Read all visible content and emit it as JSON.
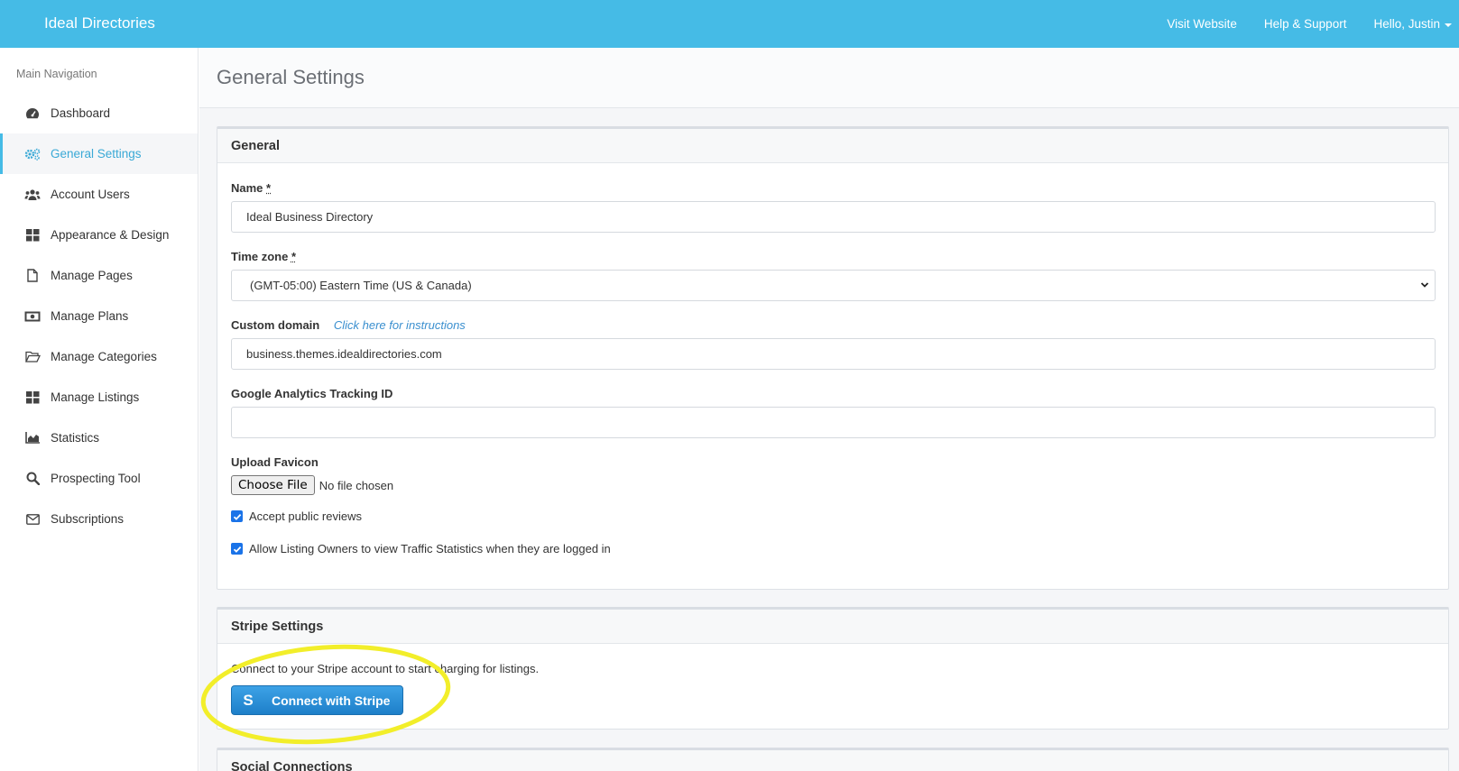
{
  "app": {
    "brand": "Ideal Directories",
    "nav": {
      "visit_website": "Visit Website",
      "help_support": "Help & Support",
      "user_greeting": "Hello, Justin"
    }
  },
  "sidebar": {
    "heading": "Main Navigation",
    "items": [
      {
        "label": "Dashboard",
        "icon": "dashboard-gauge-icon"
      },
      {
        "label": "General Settings",
        "icon": "cogs-icon",
        "active": true
      },
      {
        "label": "Account Users",
        "icon": "users-icon"
      },
      {
        "label": "Appearance & Design",
        "icon": "grid-icon"
      },
      {
        "label": "Manage Pages",
        "icon": "file-icon"
      },
      {
        "label": "Manage Plans",
        "icon": "money-bill-icon"
      },
      {
        "label": "Manage Categories",
        "icon": "folder-open-icon"
      },
      {
        "label": "Manage Listings",
        "icon": "grid-icon"
      },
      {
        "label": "Statistics",
        "icon": "chart-area-icon"
      },
      {
        "label": "Prospecting Tool",
        "icon": "search-icon"
      },
      {
        "label": "Subscriptions",
        "icon": "envelope-icon"
      }
    ]
  },
  "page": {
    "title": "General Settings"
  },
  "general": {
    "heading": "General",
    "name_label": "Name",
    "required_mark": "*",
    "name_value": "Ideal Business Directory",
    "timezone_label": "Time zone",
    "timezone_value": "(GMT-05:00) Eastern Time (US & Canada)",
    "domain_label": "Custom domain",
    "domain_instructions": "Click here for instructions",
    "domain_value": "business.themes.idealdirectories.com",
    "ga_label": "Google Analytics Tracking ID",
    "ga_value": "",
    "favicon_label": "Upload Favicon",
    "choose_file": "Choose File",
    "no_file": "No file chosen",
    "accept_reviews": "Accept public reviews",
    "accept_reviews_checked": true,
    "allow_stats": "Allow Listing Owners to view Traffic Statistics when they are logged in",
    "allow_stats_checked": true
  },
  "stripe": {
    "heading": "Stripe Settings",
    "description": "Connect to your Stripe account to start charging for listings.",
    "button_label": "Connect with Stripe",
    "button_glyph": "S",
    "highlight_color": "#f2ee2a"
  },
  "social": {
    "heading": "Social Connections"
  },
  "colors": {
    "topbar": "#45bbe6",
    "accent": "#3aa9d6",
    "checkbox": "#1a73e8"
  }
}
